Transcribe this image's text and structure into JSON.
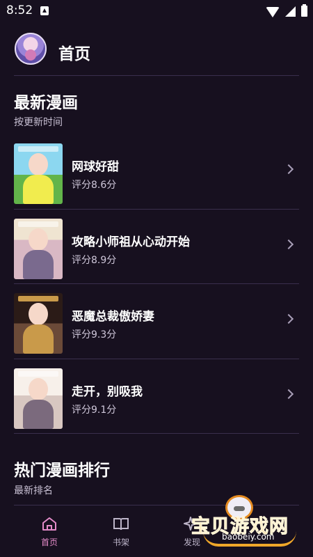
{
  "status_bar": {
    "time": "8:52",
    "icons": [
      "a-notification-icon",
      "wifi-icon",
      "signal-icon",
      "battery-icon"
    ]
  },
  "header": {
    "title": "首页",
    "avatar_icon": "avatar-icon"
  },
  "latest": {
    "title": "最新漫画",
    "subtitle": "按更新时间",
    "items": [
      {
        "title": "网球好甜",
        "rating": "评分8.6分",
        "cover_colors": [
          "#8cd7f0",
          "#62b44a",
          "#f1ec4e"
        ]
      },
      {
        "title": "攻略小师祖从心动开始",
        "rating": "评分8.9分",
        "cover_colors": [
          "#efe4d1",
          "#d9b8c4",
          "#7a6a8e"
        ]
      },
      {
        "title": "恶魔总裁傲娇妻",
        "rating": "评分9.3分",
        "cover_colors": [
          "#2b1b17",
          "#6b4a38",
          "#c99a4a"
        ]
      },
      {
        "title": "走开，别吸我",
        "rating": "评分9.1分",
        "cover_colors": [
          "#f7f0ea",
          "#d8c7c1",
          "#7b6a7d"
        ]
      }
    ]
  },
  "popular": {
    "title": "热门漫画排行",
    "subtitle": "最新排名"
  },
  "bottom_nav": [
    {
      "label": "首页",
      "icon": "home-icon",
      "active": true
    },
    {
      "label": "书架",
      "icon": "book-icon",
      "active": false
    },
    {
      "label": "发现",
      "icon": "sparkle-icon",
      "active": false
    }
  ],
  "watermark": {
    "title": "宝贝游戏网",
    "url": "baobeiy.com"
  },
  "colors": {
    "background": "#17101f",
    "divider": "#3a2f4d",
    "active": "#e48cc9",
    "inactive": "#bdb5c9"
  }
}
